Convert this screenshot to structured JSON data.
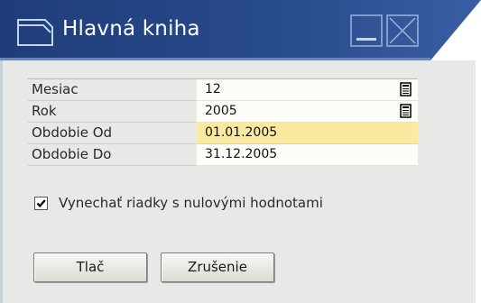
{
  "window": {
    "title": "Hlavná kniha",
    "icons": {
      "app": "window-icon",
      "minimize": "minimize-icon",
      "close": "close-icon"
    },
    "colors": {
      "titlebar_dark": "#1f3d78",
      "titlebar_light": "#7a93c4",
      "body": "#e8e8e6",
      "highlight_field": "#fbe9a0"
    }
  },
  "form": {
    "fields": [
      {
        "label": "Mesiac",
        "value": "12",
        "picker": true,
        "highlight": false
      },
      {
        "label": "Rok",
        "value": "2005",
        "picker": true,
        "highlight": false
      },
      {
        "label": "Obdobie Od",
        "value": "01.01.2005",
        "picker": false,
        "highlight": true
      },
      {
        "label": "Obdobie Do",
        "value": "31.12.2005",
        "picker": false,
        "highlight": false
      }
    ],
    "checkbox": {
      "label": "Vynechať riadky s nulovými hodnotami",
      "checked": true
    }
  },
  "buttons": {
    "print": "Tlač",
    "cancel": "Zrušenie"
  }
}
